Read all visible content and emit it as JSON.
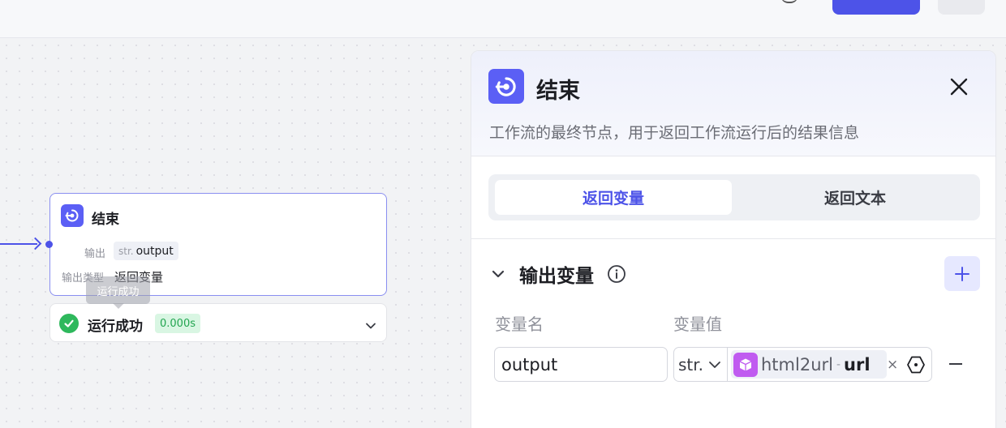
{
  "canvas_node": {
    "title": "结束",
    "output_label": "输出",
    "output_type": "str.",
    "output_name": "output",
    "output_type_label": "输出类型",
    "output_type_value": "返回变量",
    "tooltip": "运行成功",
    "status_text": "运行成功",
    "status_time": "0.000s"
  },
  "panel": {
    "title": "结束",
    "description": "工作流的最终节点，用于返回工作流运行后的结果信息",
    "tabs": [
      {
        "label": "返回变量",
        "active": true
      },
      {
        "label": "返回文本",
        "active": false
      }
    ],
    "section_title": "输出变量",
    "columns": {
      "name": "变量名",
      "value": "变量值"
    },
    "row": {
      "name_value": "output",
      "type": "str.",
      "ref_node": "html2url",
      "ref_separator": "-",
      "ref_var": "url"
    }
  },
  "colors": {
    "accent": "#4d53e8",
    "node_icon": "#5b5ff5",
    "plugin_icon": "#c05bf0",
    "success": "#2eb85c"
  }
}
